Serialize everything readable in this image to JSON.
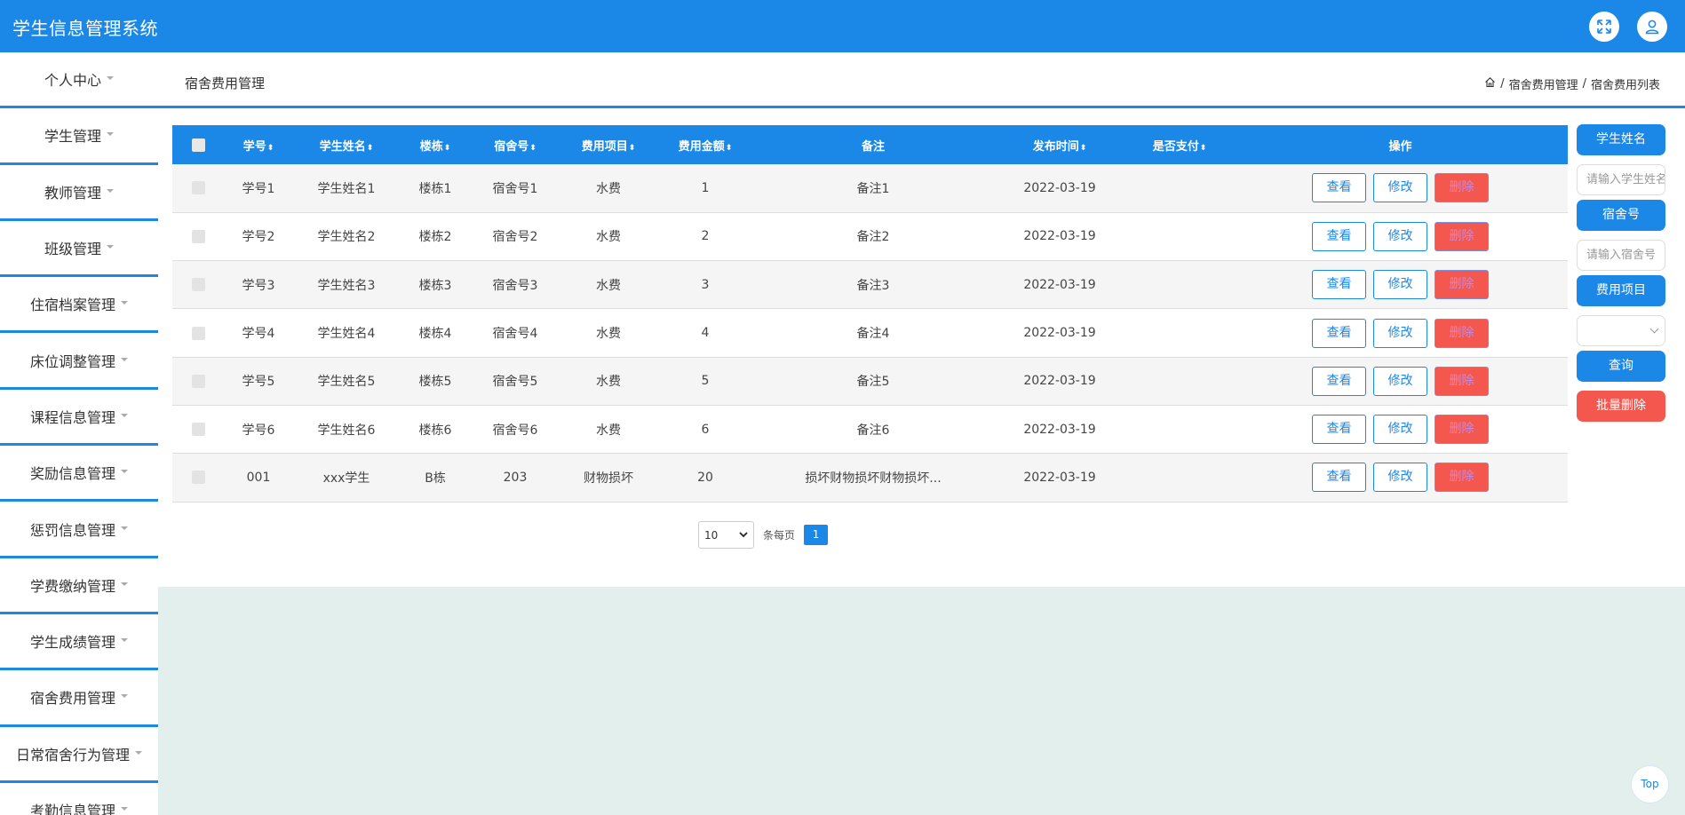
{
  "app": {
    "title": "学生信息管理系统"
  },
  "header": {
    "page_title": "宿舍费用管理",
    "breadcrumb": [
      "宿舍费用管理",
      "宿舍费用列表"
    ],
    "separator": "/"
  },
  "sidebar": {
    "items": [
      {
        "label": "个人中心"
      },
      {
        "label": "学生管理"
      },
      {
        "label": "教师管理"
      },
      {
        "label": "班级管理"
      },
      {
        "label": "住宿档案管理"
      },
      {
        "label": "床位调整管理"
      },
      {
        "label": "课程信息管理"
      },
      {
        "label": "奖励信息管理"
      },
      {
        "label": "惩罚信息管理"
      },
      {
        "label": "学费缴纳管理"
      },
      {
        "label": "学生成绩管理"
      },
      {
        "label": "宿舍费用管理"
      },
      {
        "label": "日常宿舍行为管理"
      },
      {
        "label": "考勤信息管理"
      }
    ]
  },
  "table": {
    "columns": [
      "学号",
      "学生姓名",
      "楼栋",
      "宿舍号",
      "费用项目",
      "费用金额",
      "备注",
      "发布时间",
      "是否支付",
      "操作"
    ],
    "rows": [
      {
        "id": "学号1",
        "name": "学生姓名1",
        "building": "楼栋1",
        "room": "宿舍号1",
        "item": "水费",
        "amount": "1",
        "note": "备注1",
        "time": "2022-03-19",
        "paid": ""
      },
      {
        "id": "学号2",
        "name": "学生姓名2",
        "building": "楼栋2",
        "room": "宿舍号2",
        "item": "水费",
        "amount": "2",
        "note": "备注2",
        "time": "2022-03-19",
        "paid": ""
      },
      {
        "id": "学号3",
        "name": "学生姓名3",
        "building": "楼栋3",
        "room": "宿舍号3",
        "item": "水费",
        "amount": "3",
        "note": "备注3",
        "time": "2022-03-19",
        "paid": ""
      },
      {
        "id": "学号4",
        "name": "学生姓名4",
        "building": "楼栋4",
        "room": "宿舍号4",
        "item": "水费",
        "amount": "4",
        "note": "备注4",
        "time": "2022-03-19",
        "paid": ""
      },
      {
        "id": "学号5",
        "name": "学生姓名5",
        "building": "楼栋5",
        "room": "宿舍号5",
        "item": "水费",
        "amount": "5",
        "note": "备注5",
        "time": "2022-03-19",
        "paid": ""
      },
      {
        "id": "学号6",
        "name": "学生姓名6",
        "building": "楼栋6",
        "room": "宿舍号6",
        "item": "水费",
        "amount": "6",
        "note": "备注6",
        "time": "2022-03-19",
        "paid": ""
      },
      {
        "id": "001",
        "name": "xxx学生",
        "building": "B栋",
        "room": "203",
        "item": "财物损坏",
        "amount": "20",
        "note": "损坏财物损坏财物损坏...",
        "time": "2022-03-19",
        "paid": ""
      }
    ],
    "actions": {
      "view": "查看",
      "edit": "修改",
      "delete": "删除"
    }
  },
  "pagination": {
    "page_size": "10",
    "per_page_label": "条每页",
    "current_page": "1"
  },
  "filter": {
    "name_label": "学生姓名",
    "name_placeholder": "请输入学生姓名",
    "room_label": "宿舍号",
    "room_placeholder": "请输入宿舍号",
    "item_label": "费用项目",
    "item_selected": "",
    "query_label": "查询",
    "batch_delete_label": "批量删除"
  },
  "misc": {
    "top_button": "Top"
  },
  "colors": {
    "primary": "#1b88e8",
    "danger": "#f3574d",
    "bottom_bg": "#e3efec"
  }
}
